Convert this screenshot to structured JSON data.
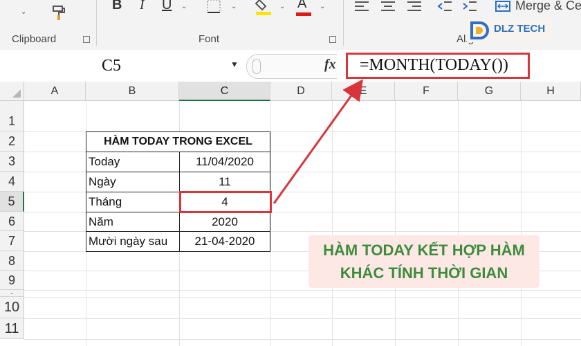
{
  "ribbon": {
    "groups": {
      "clipboard": "Clipboard",
      "font": "Font",
      "alignment": "Alignment"
    },
    "bold_label": "B",
    "italic_label": "I",
    "underline_label": "U",
    "font_color_label": "A",
    "merge_label": "Merge & Ce",
    "font_color_hex": "#e01818",
    "highlight_hex": "#ffe300"
  },
  "watermark": {
    "brand": "DLZ TECH"
  },
  "formula_bar": {
    "name_box": "C5",
    "fx_label": "fx",
    "formula": "=MONTH(TODAY())"
  },
  "columns": [
    "A",
    "B",
    "C",
    "D",
    "E",
    "F",
    "G",
    "H"
  ],
  "rows": [
    "1",
    "2",
    "3",
    "4",
    "5",
    "6",
    "7",
    "8",
    "9",
    "10",
    "11"
  ],
  "table": {
    "header": "HÀM TODAY TRONG EXCEL",
    "rows": [
      {
        "label": "Today",
        "value": "11/04/2020"
      },
      {
        "label": "Ngày",
        "value": "11"
      },
      {
        "label": "Tháng",
        "value": "4"
      },
      {
        "label": "Năm",
        "value": "2020"
      },
      {
        "label": "Mười ngày sau",
        "value": "21-04-2020"
      }
    ]
  },
  "annotation": {
    "line1": "HÀM TODAY KẾT HỢP HÀM",
    "line2": "KHÁC TÍNH THỜI GIAN",
    "highlight_color": "#d9343a",
    "text_color": "#3d8c3b"
  }
}
